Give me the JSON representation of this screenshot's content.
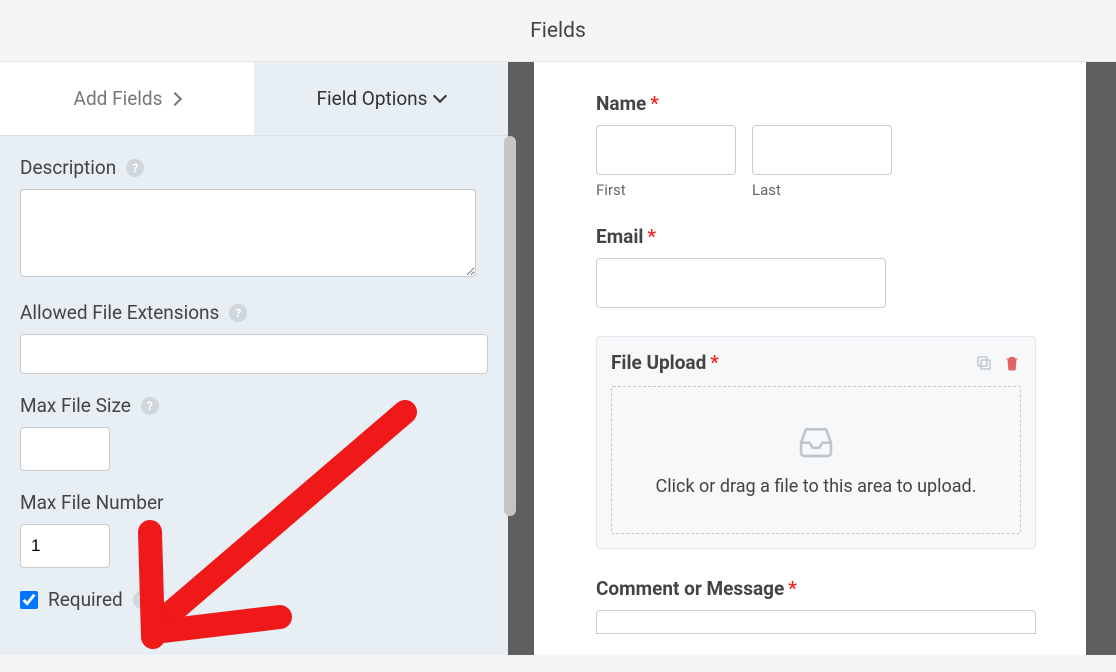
{
  "header": {
    "title": "Fields"
  },
  "tabs": {
    "add_fields": "Add Fields",
    "field_options": "Field Options"
  },
  "options": {
    "description": {
      "label": "Description",
      "value": ""
    },
    "allowed_ext": {
      "label": "Allowed File Extensions",
      "value": ""
    },
    "max_size": {
      "label": "Max File Size",
      "value": ""
    },
    "max_number": {
      "label": "Max File Number",
      "value": "1"
    },
    "required": {
      "label": "Required",
      "checked": true
    }
  },
  "preview": {
    "name": {
      "label": "Name",
      "first": "First",
      "last": "Last"
    },
    "email": {
      "label": "Email"
    },
    "upload": {
      "label": "File Upload",
      "dropzone": "Click or drag a file to this area to upload."
    },
    "comment": {
      "label": "Comment or Message"
    }
  },
  "help_glyph": "?"
}
